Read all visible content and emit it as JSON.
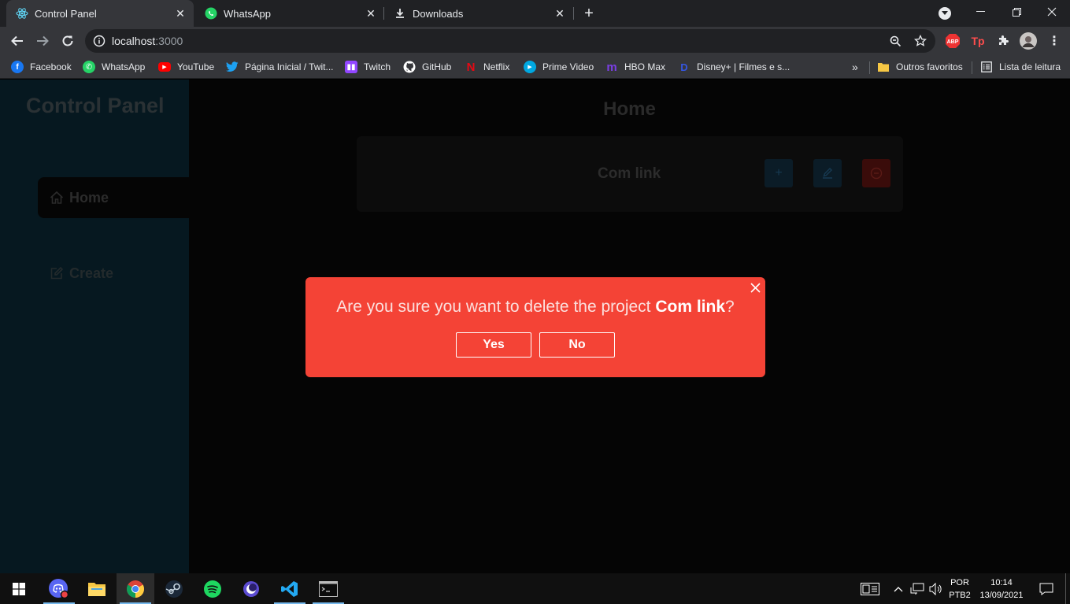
{
  "browser": {
    "tabs": [
      {
        "title": "Control Panel",
        "icon": "react-icon",
        "active": true
      },
      {
        "title": "WhatsApp",
        "icon": "whatsapp-icon",
        "active": false
      },
      {
        "title": "Downloads",
        "icon": "download-icon",
        "active": false
      }
    ],
    "url_host": "localhost",
    "url_port": ":3000",
    "bookmarks": [
      {
        "label": "Facebook",
        "icon": "facebook-icon",
        "color": "#1877f2"
      },
      {
        "label": "WhatsApp",
        "icon": "whatsapp-icon",
        "color": "#25d366"
      },
      {
        "label": "YouTube",
        "icon": "youtube-icon",
        "color": "#ff0000"
      },
      {
        "label": "Página Inicial / Twit...",
        "icon": "twitter-icon",
        "color": "#1da1f2"
      },
      {
        "label": "Twitch",
        "icon": "twitch-icon",
        "color": "#9146ff"
      },
      {
        "label": "GitHub",
        "icon": "github-icon",
        "color": "#ffffff"
      },
      {
        "label": "Netflix",
        "icon": "netflix-icon",
        "color": "#e50914"
      },
      {
        "label": "Prime Video",
        "icon": "prime-video-icon",
        "color": "#00a8e1"
      },
      {
        "label": "HBO Max",
        "icon": "hbo-max-icon",
        "color": "#5822b4"
      },
      {
        "label": "Disney+ | Filmes e s...",
        "icon": "disney-plus-icon",
        "color": "#113ccf"
      }
    ],
    "other_bookmarks": "Outros favoritos",
    "reading_list": "Lista de leitura",
    "ext_abp": "ABP",
    "ext_tp": "Tp"
  },
  "app": {
    "brand": "Control Panel",
    "nav": [
      {
        "label": "Home",
        "icon": "home-icon"
      },
      {
        "label": "Create",
        "icon": "edit-icon"
      }
    ],
    "page_title": "Home",
    "project": {
      "name": "Com link"
    }
  },
  "modal": {
    "message_prefix": "Are you sure you want to delete the project ",
    "project_name": "Com link",
    "message_suffix": "?",
    "yes_label": "Yes",
    "no_label": "No"
  },
  "taskbar": {
    "lang_top": "POR",
    "lang_bottom": "PTB2",
    "time": "10:14",
    "date": "13/09/2021"
  },
  "colors": {
    "modal_bg": "#f44336",
    "sidebar_bg": "#061820",
    "accent_blue": "#76b9ed"
  }
}
